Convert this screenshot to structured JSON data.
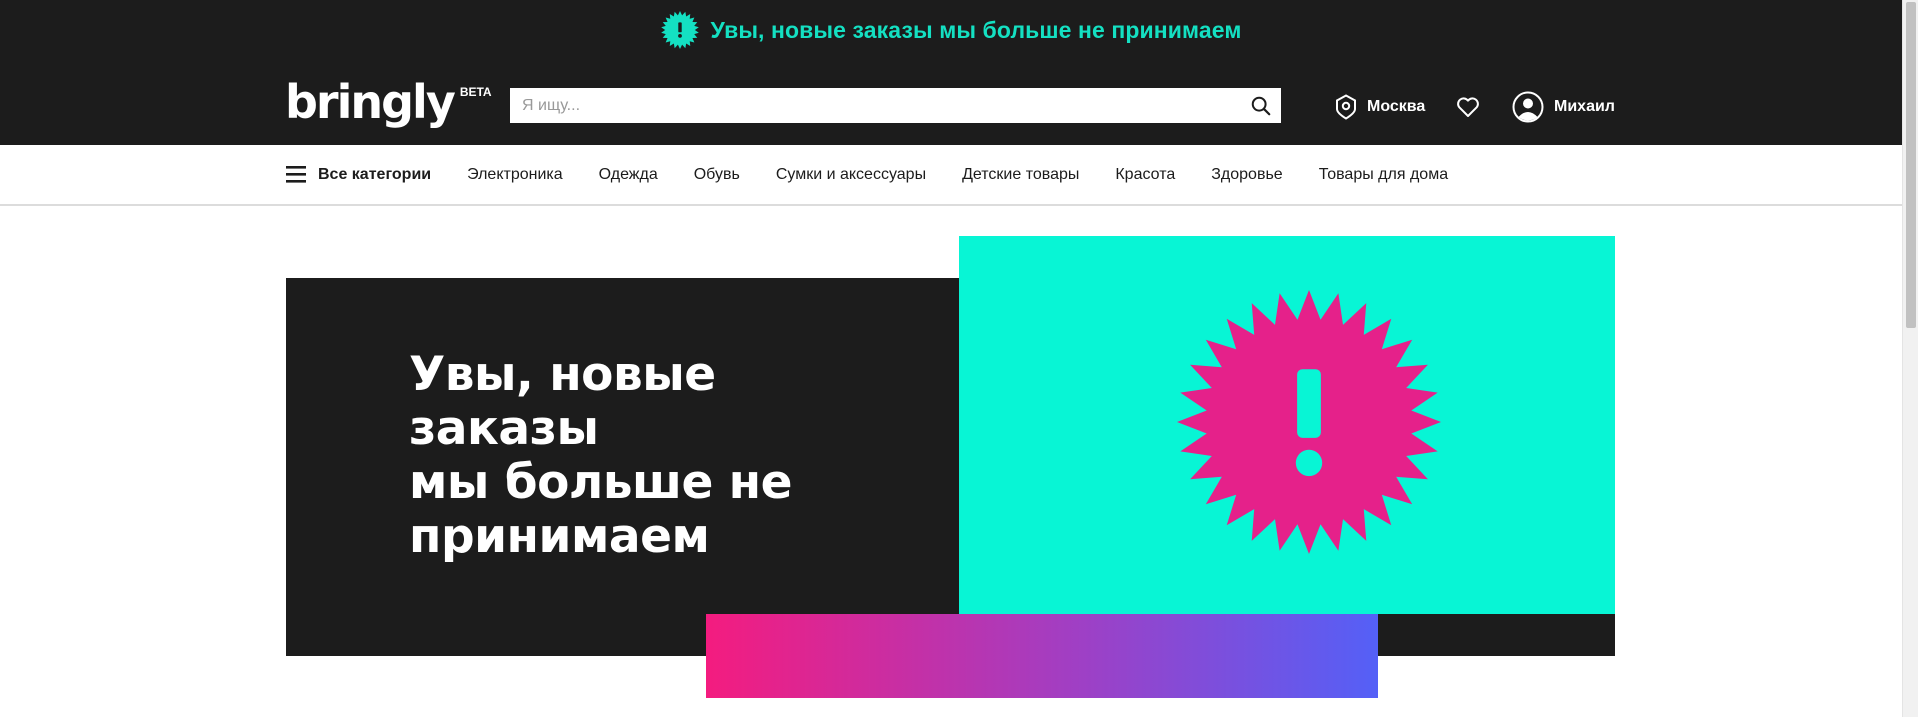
{
  "header": {
    "notice_text": "Увы, новые заказы мы больше не принимаем",
    "notice_icon": "exclamation-burst-icon",
    "logo_word": "bringly",
    "logo_badge": "BETA",
    "search": {
      "placeholder": "Я ищу...",
      "icon": "search-icon"
    },
    "city": {
      "label": "Москва",
      "icon": "location-pin-icon"
    },
    "favorites": {
      "icon": "heart-icon"
    },
    "user": {
      "name": "Михаил",
      "icon": "user-avatar-icon"
    }
  },
  "nav": {
    "all_categories": "Все категории",
    "menu_icon": "hamburger-menu-icon",
    "items": [
      "Электроника",
      "Одежда",
      "Обувь",
      "Сумки и аксессуары",
      "Детские товары",
      "Красота",
      "Здоровье",
      "Товары для дома"
    ]
  },
  "hero": {
    "title_lines": [
      "Увы, новые",
      "заказы",
      "мы больше не",
      "принимаем"
    ],
    "burst_icon": "exclamation-burst-icon"
  },
  "colors": {
    "dark": "#1c1c1c",
    "teal": "#08f5d5",
    "notice_teal": "#14e0c2",
    "pink": "#e5218a",
    "gradient_start": "#f41c7f",
    "gradient_end": "#5460f7"
  }
}
